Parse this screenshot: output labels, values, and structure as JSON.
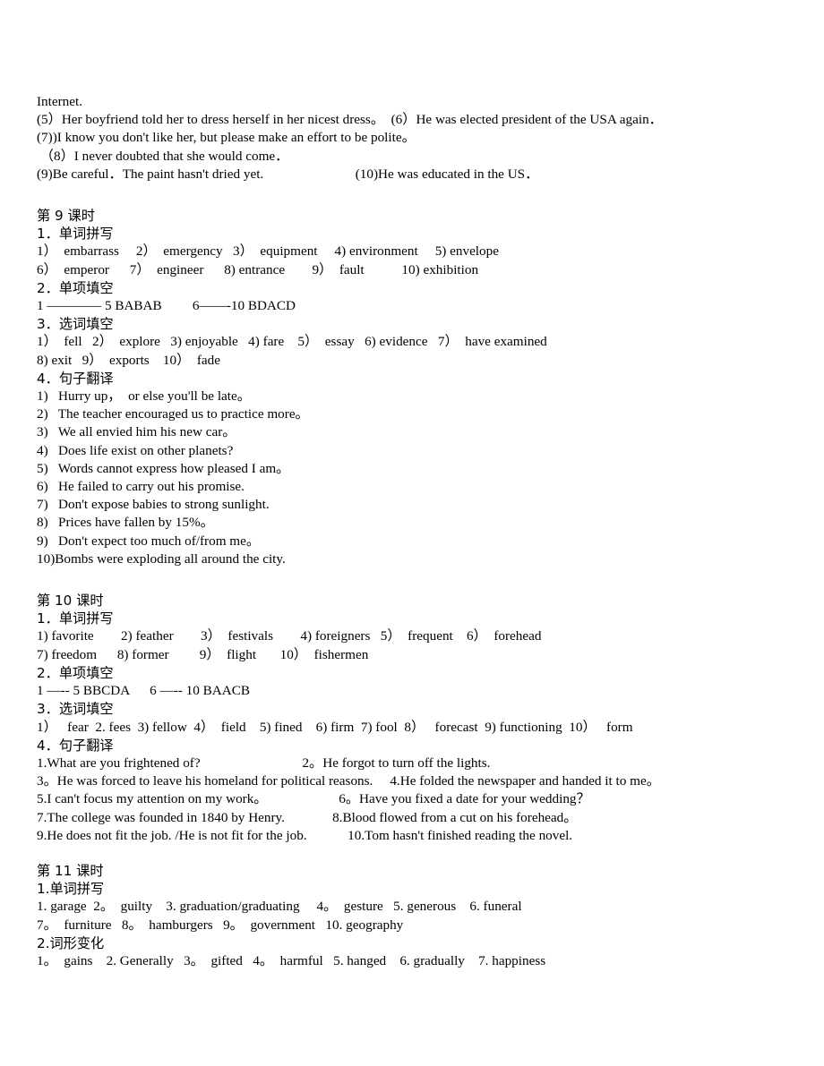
{
  "document": {
    "title": "英语答案 第9-11课时",
    "page_background": "#ffffff",
    "text_color": "#000000"
  },
  "blocks": [
    {
      "id": "carryover",
      "lines": [
        "Internet.",
        "(5）Her boyfriend told her to dress herself in her nicest dress。  (6）He was elected president of the USA again．",
        "(7))I know you don't like her, but please make an effort to be polite。",
        " （8）I never doubted that she would come．",
        "(9)Be careful．The paint hasn't dried yet.                           (10)He was educated in the US．"
      ]
    },
    {
      "id": "lesson-9",
      "heading": "第 9 课时",
      "sections": [
        {
          "title": "1．单词拼写",
          "lines": [
            "1）  embarrass     2）  emergency   3）  equipment     4) environment     5) envelope",
            "6）  emperor      7）  engineer      8) entrance        9）  fault           10) exhibition"
          ]
        },
        {
          "title": "2．单项填空",
          "lines": [
            "1 ———— 5 BABAB         6——-10 BDACD"
          ]
        },
        {
          "title": "3．选词填空",
          "lines": [
            "1）  fell   2）  explore   3) enjoyable   4) fare    5）  essay   6) evidence   7）  have examined",
            "8) exit   9）  exports    10）  fade"
          ]
        },
        {
          "title": "4．句子翻译",
          "lines": [
            "1)   Hurry up，  or else you'll be late。",
            "2)   The teacher encouraged us to practice more。",
            "3)   We all envied him his new car。",
            "4)   Does life exist on other planets?",
            "5)   Words cannot express how pleased I am。",
            "6)   He failed to carry out his promise.",
            "7)   Don't expose babies to strong sunlight.",
            "8)   Prices have fallen by 15%。",
            "9)   Don't expect too much of/from me。",
            "10)Bombs were exploding all around the city."
          ]
        }
      ]
    },
    {
      "id": "lesson-10",
      "heading": "第 10 课时",
      "sections": [
        {
          "title": "1．单词拼写",
          "lines": [
            "1) favorite        2) feather        3）  festivals        4) foreigners   5）  frequent    6）  forehead",
            "7) freedom      8) former         9）  flight       10）  fishermen"
          ]
        },
        {
          "title": "2．单项填空",
          "lines": [
            "1 —-- 5 BBCDA      6 —-- 10 BAACB"
          ]
        },
        {
          "title": "3．选词填空",
          "lines": [
            "1）   fear  2. fees  3) fellow  4）  field    5) fined    6) firm  7) fool  8）   forecast  9) functioning  10）   form"
          ]
        },
        {
          "title": "4．句子翻译",
          "lines": [
            "1.What are you frightened of?                              2。He forgot to turn off the lights.",
            "3。He was forced to leave his homeland for political reasons.     4.He folded the newspaper and handed it to me。",
            "5.I can't focus my attention on my work。                     6。Have you fixed a date for your wedding？",
            "7.The college was founded in 1840 by Henry.              8.Blood flowed from a cut on his forehead。",
            "9.He does not fit the job. /He is not fit for the job.            10.Tom hasn't finished reading the novel."
          ]
        }
      ]
    },
    {
      "id": "lesson-11",
      "heading": "第 11 课时",
      "sections": [
        {
          "title": "1.单词拼写",
          "lines": [
            "1. garage  2。  guilty    3. graduation/graduating     4。  gesture   5. generous    6. funeral",
            "7。  furniture   8。  hamburgers   9。  government   10. geography"
          ]
        },
        {
          "title": "2.词形变化",
          "lines": [
            "1。  gains    2. Generally   3。  gifted   4。  harmful   5. hanged    6. gradually    7. happiness"
          ]
        }
      ]
    }
  ]
}
